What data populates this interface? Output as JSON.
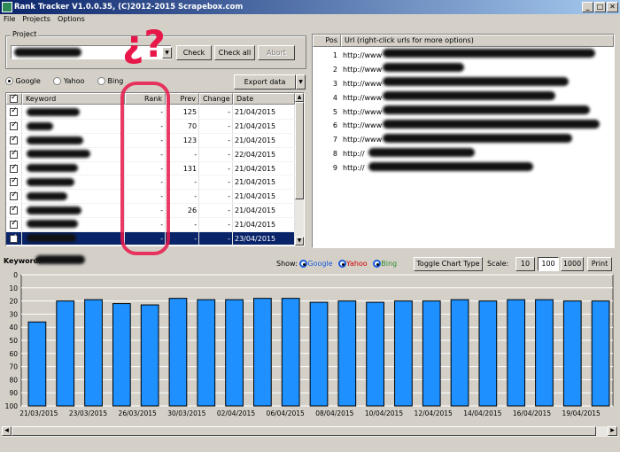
{
  "window": {
    "title": "Rank Tracker V1.0.0.35, (C)2012-2015 Scrapebox.com"
  },
  "menu": [
    "File",
    "Projects",
    "Options"
  ],
  "project": {
    "group_label": "Project",
    "value": "",
    "check_label": "Check",
    "check_all_label": "Check all",
    "abort_label": "Abort"
  },
  "annotation": {
    "text": "¿?"
  },
  "engines": {
    "google": "Google",
    "yahoo": "Yahoo",
    "bing": "Bing",
    "selected": "Google"
  },
  "export_label": "Export data",
  "keyword_table": {
    "headers": [
      "Keyword",
      "Rank",
      "Prev",
      "Change",
      "Date"
    ],
    "rows": [
      {
        "keyword": "",
        "rank": "-",
        "prev": "125",
        "change": "-",
        "date": "21/04/2015"
      },
      {
        "keyword": "",
        "rank": "-",
        "prev": "70",
        "change": "-",
        "date": "21/04/2015"
      },
      {
        "keyword": "",
        "rank": "-",
        "prev": "123",
        "change": "-",
        "date": "21/04/2015"
      },
      {
        "keyword": "",
        "rank": "-",
        "prev": "-",
        "change": "-",
        "date": "22/04/2015"
      },
      {
        "keyword": "",
        "rank": "-",
        "prev": "131",
        "change": "-",
        "date": "21/04/2015"
      },
      {
        "keyword": "",
        "rank": "-",
        "prev": "-",
        "change": "-",
        "date": "21/04/2015"
      },
      {
        "keyword": "",
        "rank": "-",
        "prev": "-",
        "change": "-",
        "date": "21/04/2015"
      },
      {
        "keyword": "",
        "rank": "-",
        "prev": "26",
        "change": "-",
        "date": "21/04/2015"
      },
      {
        "keyword": "",
        "rank": "-",
        "prev": "-",
        "change": "-",
        "date": "21/04/2015"
      },
      {
        "keyword": "",
        "rank": "-",
        "prev": "-",
        "change": "-",
        "date": "23/04/2015"
      }
    ],
    "selected_row": 9
  },
  "url_table": {
    "headers": [
      "Pos",
      "Url (right-click urls for more options)"
    ],
    "rows": [
      {
        "pos": "1",
        "url": "http://www"
      },
      {
        "pos": "2",
        "url": "http://www"
      },
      {
        "pos": "3",
        "url": "http://www"
      },
      {
        "pos": "4",
        "url": "http://www"
      },
      {
        "pos": "5",
        "url": "http://www"
      },
      {
        "pos": "6",
        "url": "http://www"
      },
      {
        "pos": "7",
        "url": "http://www"
      },
      {
        "pos": "8",
        "url": "http://"
      },
      {
        "pos": "9",
        "url": "http://"
      }
    ]
  },
  "keyword_label": "Keyword:",
  "chart_controls": {
    "show_label": "Show:",
    "google": "Google",
    "yahoo": "Yahoo",
    "bing": "Bing",
    "toggle_label": "Toggle Chart Type",
    "scale_label": "Scale:",
    "scale_options": [
      "10",
      "100",
      "1000"
    ],
    "scale_selected": "100",
    "print_label": "Print"
  },
  "colors": {
    "google": "#1a5bd8",
    "yahoo": "#cc0000",
    "bing": "#2e8b2e",
    "bar": "#1e90ff",
    "annotation": "#e8174a"
  },
  "chart_data": {
    "type": "bar",
    "ylim": [
      0,
      100
    ],
    "y_inverted": true,
    "y_ticks": [
      "0",
      "10",
      "20",
      "30",
      "40",
      "50",
      "60",
      "70",
      "80",
      "90",
      "100"
    ],
    "x_tick_labels": [
      "21/03/2015",
      "23/03/2015",
      "26/03/2015",
      "30/03/2015",
      "02/04/2015",
      "06/04/2015",
      "08/04/2015",
      "10/04/2015",
      "12/04/2015",
      "14/04/2015",
      "16/04/2015",
      "19/04/2015"
    ],
    "values": [
      36,
      20,
      19,
      22,
      23,
      18,
      19,
      19,
      18,
      18,
      21,
      20,
      21,
      20,
      20,
      19,
      20,
      19,
      19,
      20,
      20
    ],
    "grid": true
  }
}
